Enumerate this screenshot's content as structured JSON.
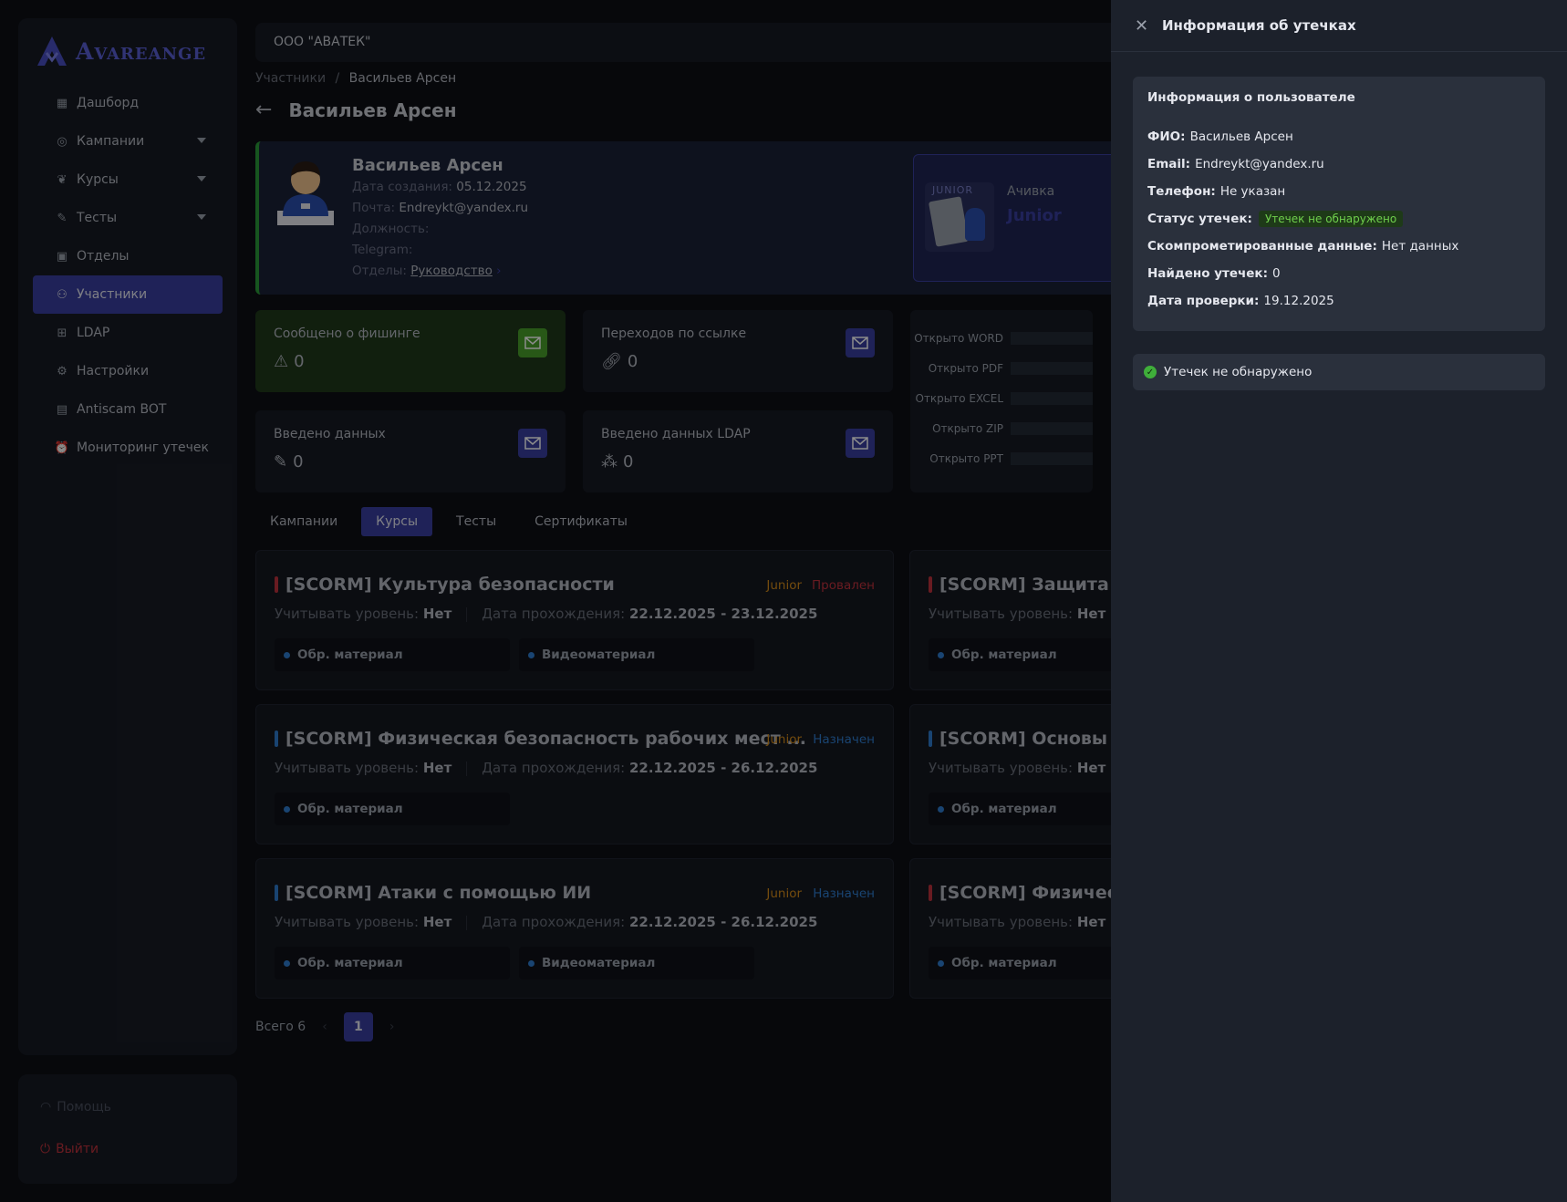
{
  "brand": {
    "logo_text": "Avareange"
  },
  "sidebar": {
    "items": [
      {
        "label": "Дашборд",
        "icon": "grid-icon"
      },
      {
        "label": "Кампании",
        "icon": "target-icon"
      },
      {
        "label": "Курсы",
        "icon": "brain-icon"
      },
      {
        "label": "Тесты",
        "icon": "edit-icon"
      },
      {
        "label": "Отделы",
        "icon": "building-icon"
      },
      {
        "label": "Участники",
        "icon": "users-icon"
      },
      {
        "label": "LDAP",
        "icon": "network-icon"
      },
      {
        "label": "Настройки",
        "icon": "gear-icon"
      },
      {
        "label": "Antiscam BOT",
        "icon": "bot-icon"
      },
      {
        "label": "Мониторинг утечек",
        "icon": "alarm-icon"
      }
    ],
    "help": "Помощь",
    "logout": "Выйти"
  },
  "topbar": {
    "org": "ООО \"АВАТЕК\""
  },
  "breadcrumb": {
    "parent": "Участники",
    "sep": "/",
    "current": "Васильев Арсен"
  },
  "page": {
    "title": "Васильев Арсен"
  },
  "profile": {
    "name": "Васильев Арсен",
    "created_label": "Дата создания:",
    "created": "05.12.2025",
    "email_label": "Почта:",
    "email": "Endreykt@yandex.ru",
    "position_label": "Должность:",
    "telegram_label": "Telegram:",
    "dept_label": "Отделы:",
    "dept": "Руководство",
    "achievement_label": "Ачивка",
    "achievement": "Junior",
    "achievement_img_text": "JUNIOR"
  },
  "stats": [
    {
      "label": "Сообщено о фишинге",
      "value": "0"
    },
    {
      "label": "Переходов по ссылке",
      "value": "0"
    },
    {
      "label": "Введено данных",
      "value": "0"
    },
    {
      "label": "Введено данных LDAP",
      "value": "0"
    }
  ],
  "chart_data": {
    "type": "bar",
    "categories": [
      "Открыто WORD",
      "Открыто PDF",
      "Открыто EXCEL",
      "Открыто ZIP",
      "Открыто PPT"
    ],
    "values": [
      0,
      0,
      0,
      0,
      0
    ]
  },
  "tabs": [
    "Кампании",
    "Курсы",
    "Тесты",
    "Сертификаты"
  ],
  "courses": [
    {
      "title": "[SCORM] Культура безопасности",
      "level": "Junior",
      "status": "Провален",
      "level_label": "Учитывать уровень:",
      "level_val": "Нет",
      "date_label": "Дата прохождения:",
      "date": "22.12.2025 - 23.12.2025",
      "chips": [
        "Обр. материал",
        "Видеоматериал"
      ]
    },
    {
      "title": "[SCORM] Защита пе",
      "level_label": "Учитывать уровень:",
      "level_val": "Нет",
      "chips": [
        "Обр. материал"
      ]
    },
    {
      "title": "[SCORM] Физическая безопасность рабочих мест ...",
      "level": "Junior",
      "status": "Назначен",
      "level_label": "Учитывать уровень:",
      "level_val": "Нет",
      "date_label": "Дата прохождения:",
      "date": "22.12.2025 - 26.12.2025",
      "chips": [
        "Обр. материал"
      ]
    },
    {
      "title": "[SCORM] Основы к",
      "level_label": "Учитывать уровень:",
      "level_val": "Нет",
      "chips": [
        "Обр. материал"
      ]
    },
    {
      "title": "[SCORM] Атаки с помощью ИИ",
      "level": "Junior",
      "status": "Назначен",
      "level_label": "Учитывать уровень:",
      "level_val": "Нет",
      "date_label": "Дата прохождения:",
      "date": "22.12.2025 - 26.12.2025",
      "chips": [
        "Обр. материал",
        "Видеоматериал"
      ]
    },
    {
      "title": "[SCORM] Физическ",
      "level_label": "Учитывать уровень:",
      "level_val": "Нет",
      "chips": [
        "Обр. материал"
      ]
    }
  ],
  "pager": {
    "total": "Всего 6",
    "page": "1"
  },
  "drawer": {
    "title": "Информация об утечках",
    "card_title": "Информация о пользователе",
    "rows": [
      {
        "label": "ФИО:",
        "value": "Васильев Арсен"
      },
      {
        "label": "Email:",
        "value": "Endreykt@yandex.ru"
      },
      {
        "label": "Телефон:",
        "value": "Не указан"
      },
      {
        "label": "Статус утечек:",
        "value": "Утечек не обнаружено"
      },
      {
        "label": "Скомпрометированные данные:",
        "value": "Нет данных"
      },
      {
        "label": "Найдено утечек:",
        "value": "0"
      },
      {
        "label": "Дата проверки:",
        "value": "19.12.2025"
      }
    ],
    "result": "Утечек не обнаружено"
  },
  "colors": {
    "accent": "#3a3fa0",
    "success": "#3fae3a",
    "danger": "#c0323c",
    "warning": "#d48a1a",
    "info": "#2f7dd0"
  }
}
